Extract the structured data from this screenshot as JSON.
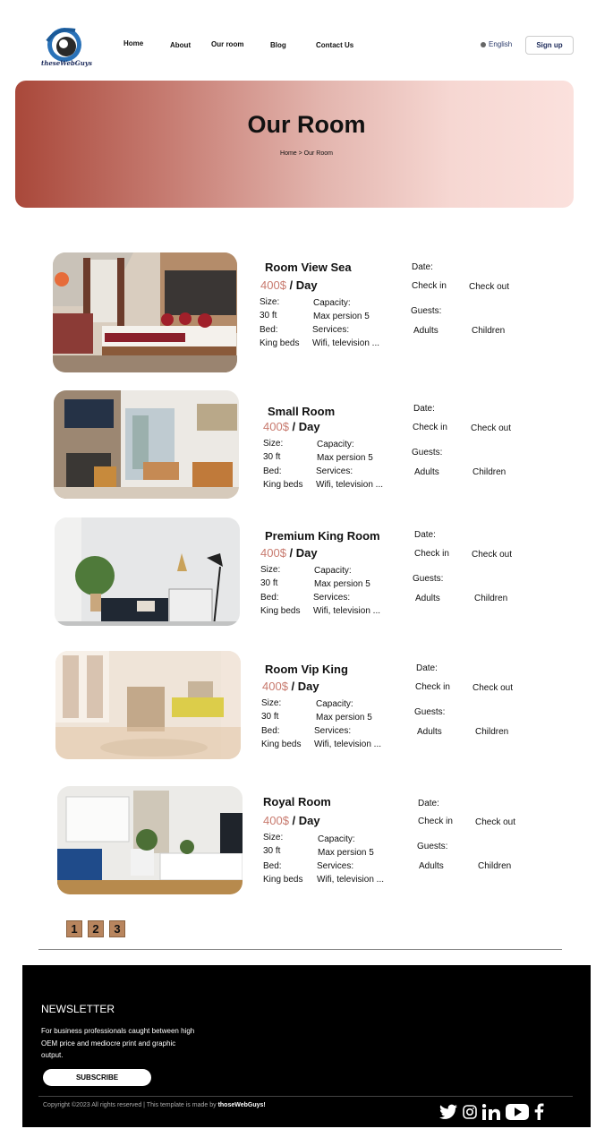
{
  "header": {
    "logo_text": "theseWebGuys",
    "nav": [
      "Home",
      "About",
      "Our room",
      "Blog",
      "Contact Us"
    ],
    "language": "English",
    "signup": "Sign up"
  },
  "hero": {
    "title": "Our Room",
    "breadcrumb": "Home > Our Room"
  },
  "rooms": [
    {
      "name": "Room View Sea",
      "price": "400$",
      "per": "/ Day",
      "size_label": "Size:",
      "size": "30 ft",
      "capacity_label": "Capacity:",
      "capacity": "Max persion 5",
      "bed_label": "Bed:",
      "bed": "King beds",
      "services_label": "Services:",
      "services": "Wifi, television ...",
      "date_label": "Date:",
      "check_in": "Check in",
      "check_out": "Check out",
      "guests_label": "Guests:",
      "adults": "Adults",
      "children": "Children"
    },
    {
      "name": "Small Room",
      "price": "400$",
      "per": "/ Day",
      "size_label": "Size:",
      "size": "30 ft",
      "capacity_label": "Capacity:",
      "capacity": "Max persion 5",
      "bed_label": "Bed:",
      "bed": "King beds",
      "services_label": "Services:",
      "services": "Wifi, television ...",
      "date_label": "Date:",
      "check_in": "Check in",
      "check_out": "Check out",
      "guests_label": "Guests:",
      "adults": "Adults",
      "children": "Children"
    },
    {
      "name": "Premium King Room",
      "price": "400$",
      "per": "/ Day",
      "size_label": "Size:",
      "size": "30 ft",
      "capacity_label": "Capacity:",
      "capacity": "Max persion 5",
      "bed_label": "Bed:",
      "bed": "King beds",
      "services_label": "Services:",
      "services": "Wifi, television ...",
      "date_label": "Date:",
      "check_in": "Check in",
      "check_out": "Check out",
      "guests_label": "Guests:",
      "adults": "Adults",
      "children": "Children"
    },
    {
      "name": "Room Vip King",
      "price": "400$",
      "per": "/ Day",
      "size_label": "Size:",
      "size": "30 ft",
      "capacity_label": "Capacity:",
      "capacity": "Max persion 5",
      "bed_label": "Bed:",
      "bed": "King beds",
      "services_label": "Services:",
      "services": "Wifi, television ...",
      "date_label": "Date:",
      "check_in": "Check in",
      "check_out": "Check out",
      "guests_label": "Guests:",
      "adults": "Adults",
      "children": "Children"
    },
    {
      "name": "Royal Room",
      "price": "400$",
      "per": "/ Day",
      "size_label": "Size:",
      "size": "30 ft",
      "capacity_label": "Capacity:",
      "capacity": "Max persion 5",
      "bed_label": "Bed:",
      "bed": "King beds",
      "services_label": "Services:",
      "services": "Wifi, television ...",
      "date_label": "Date:",
      "check_in": "Check in",
      "check_out": "Check out",
      "guests_label": "Guests:",
      "adults": "Adults",
      "children": "Children"
    }
  ],
  "pagination": [
    "1",
    "2",
    "3"
  ],
  "footer": {
    "newsletter_title": "NEWSLETTER",
    "newsletter_text": "For business professionals caught between high OEM price and mediocre print and graphic output.",
    "subscribe": "SUBSCRIBE",
    "copyright": "Copyright ©2023 All rights reserved | This template is made by",
    "brand": "thoseWebGuys!",
    "socials": [
      "twitter-icon",
      "instagram-icon",
      "linkedin-icon",
      "youtube-icon",
      "facebook-icon"
    ]
  },
  "colors": {
    "accent": "#c87a6e",
    "hero_start": "#a9483a",
    "hero_end": "#fbe1dd",
    "page_button": "#b8855e"
  }
}
